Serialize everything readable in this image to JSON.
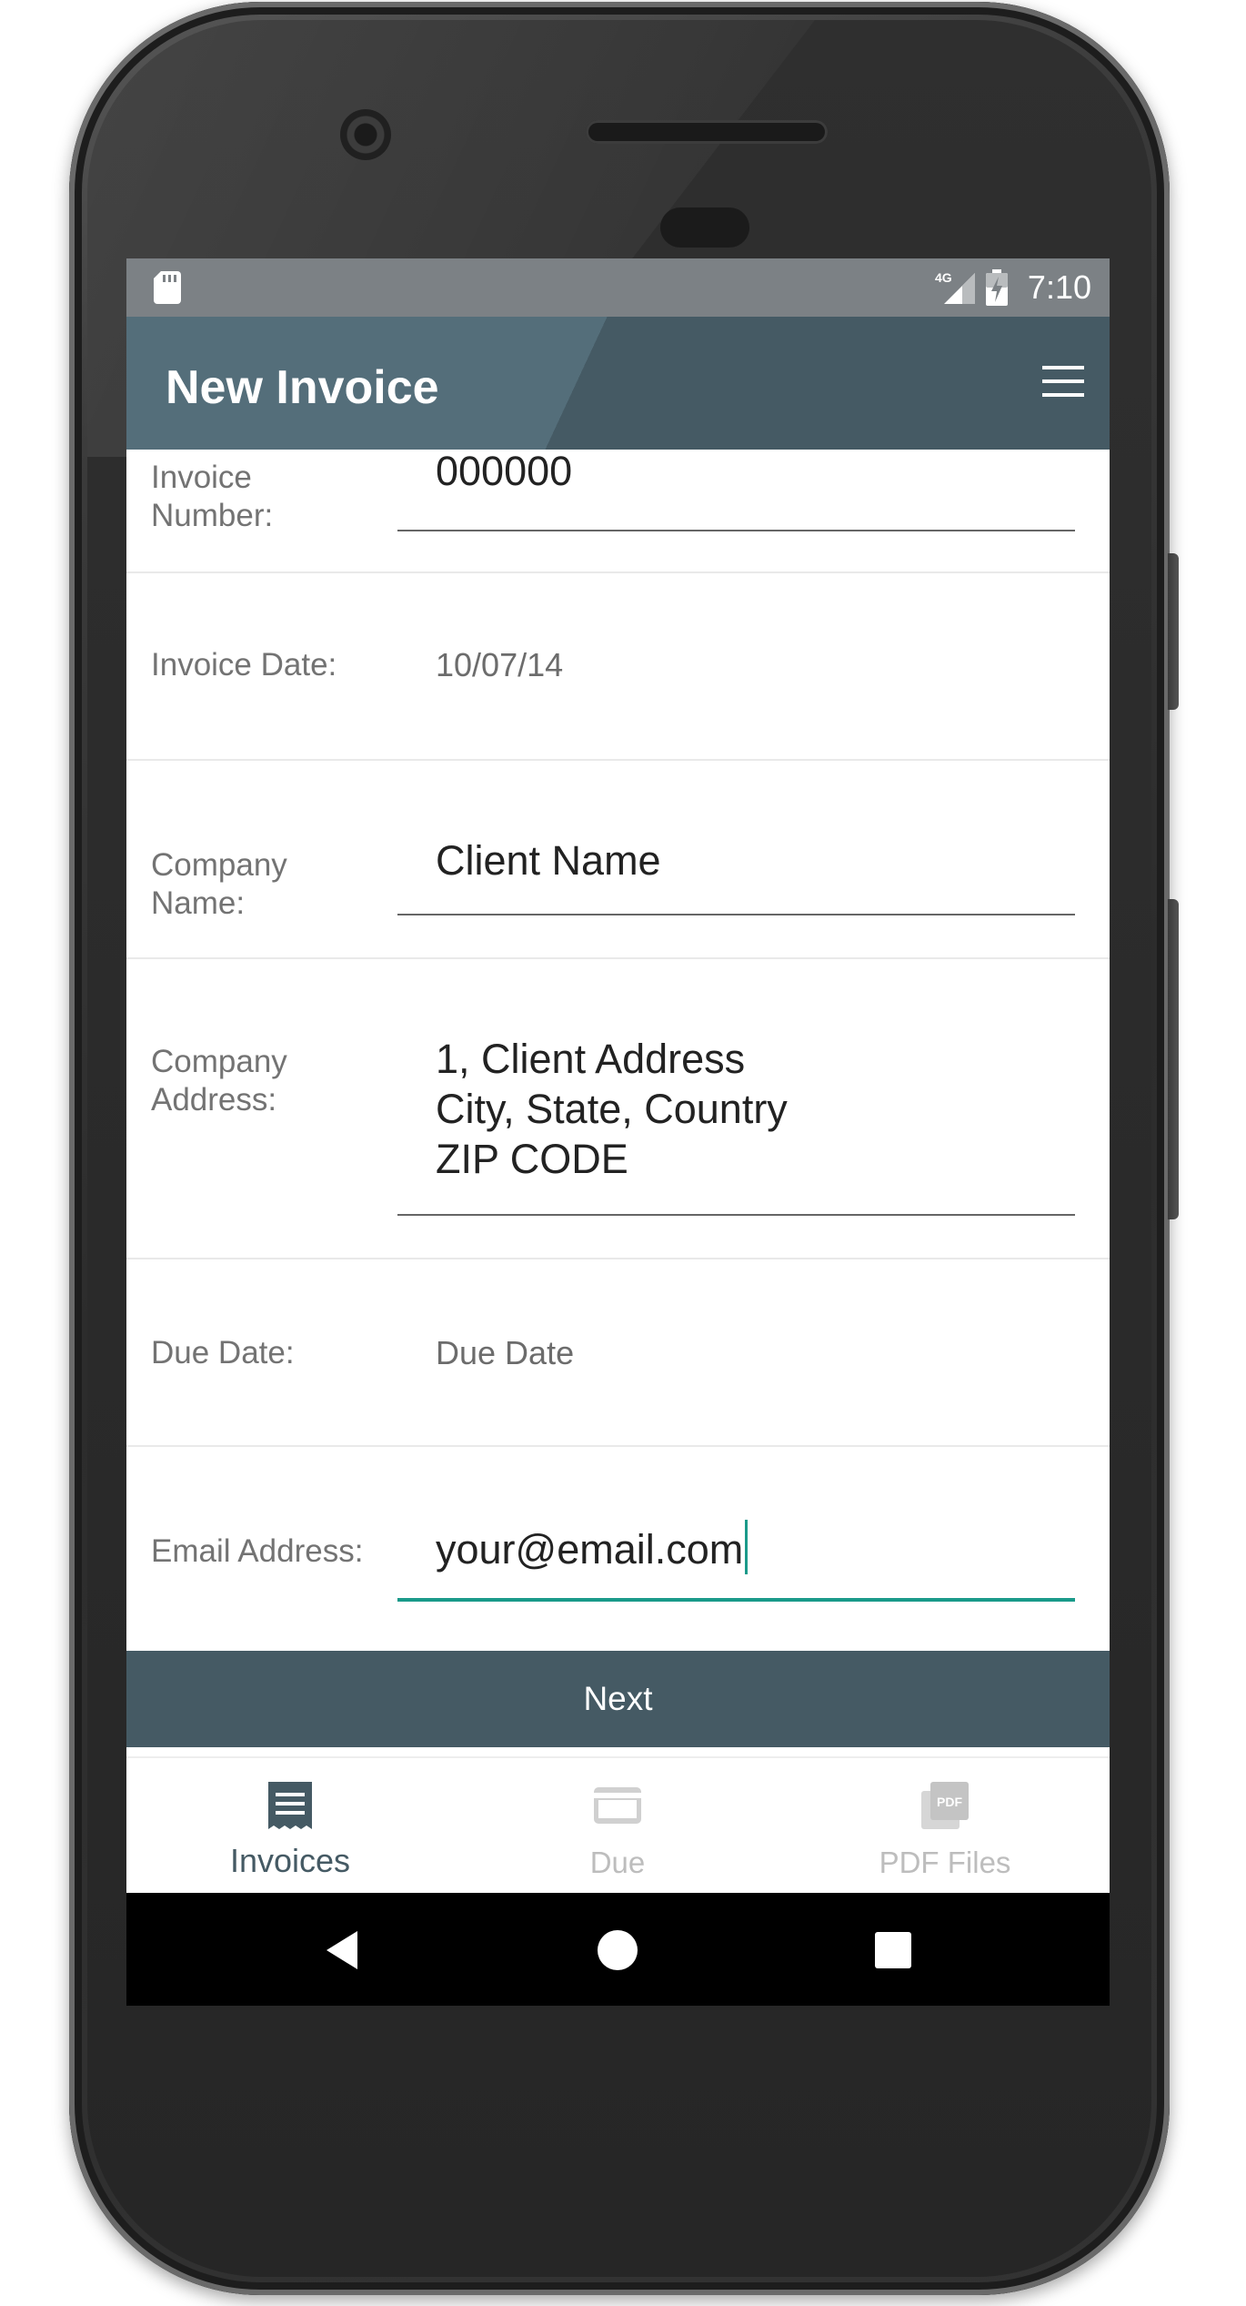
{
  "status_bar": {
    "network": "4G",
    "time": "7:10"
  },
  "app_bar": {
    "title": "New Invoice",
    "menu_icon": "hamburger-menu-icon"
  },
  "form": {
    "invoice_number": {
      "label": "Invoice\nNumber:",
      "value": "000000"
    },
    "invoice_date": {
      "label": "Invoice Date:",
      "value": "10/07/14"
    },
    "company_name": {
      "label": "Company\nName:",
      "value": "Client Name"
    },
    "company_address": {
      "label": "Company\nAddress:",
      "value": "1, Client Address\nCity, State, Country\nZIP CODE"
    },
    "due_date": {
      "label": "Due Date:",
      "placeholder": "Due Date"
    },
    "email_address": {
      "label": "Email Address:",
      "value": "your@email.com"
    }
  },
  "next_button": {
    "label": "Next"
  },
  "bottom_nav": {
    "items": [
      {
        "label": "Invoices",
        "icon": "receipt-icon",
        "active": true
      },
      {
        "label": "Due",
        "icon": "credit-card-icon",
        "active": false
      },
      {
        "label": "PDF Files",
        "icon": "pdf-icon",
        "active": false
      }
    ]
  },
  "colors": {
    "primary": "#455a64",
    "primary_light": "#546e7a",
    "accent": "#1a9a8a",
    "status_bar": "#7c8185"
  }
}
